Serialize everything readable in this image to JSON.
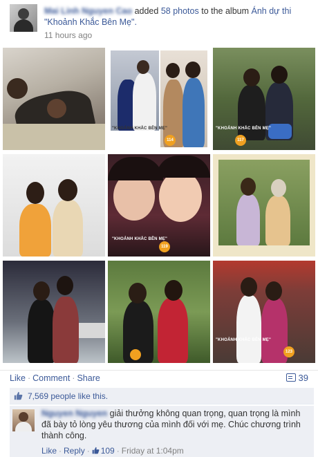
{
  "post": {
    "author_blurred": "Mai Linh Nguyen Cao",
    "action_text": "added",
    "photo_count": "58 photos",
    "to_album_text": "to the album",
    "album_name": "Ánh dự thi \"Khoảnh Khắc Bên Mẹ\".",
    "timestamp": "11 hours ago"
  },
  "photos": [
    {
      "id": "1"
    },
    {
      "id": "2",
      "frame_text": "\"KHOẢNH KHẮC BÊN MẸ\"",
      "badge": "114"
    },
    {
      "id": "3",
      "frame_text": "\"KHOẢNH KHẮC BÊN MẸ\"",
      "badge": "117"
    },
    {
      "id": "4"
    },
    {
      "id": "5",
      "frame_text": "\"KHOẢNH KHẮC BÊN MẸ\"",
      "badge": "119"
    },
    {
      "id": "6"
    },
    {
      "id": "7"
    },
    {
      "id": "8"
    },
    {
      "id": "9",
      "frame_text": "\"KHOẢNH KHẮC BÊN MẸ\"",
      "badge": "123"
    }
  ],
  "actions": {
    "like": "Like",
    "comment": "Comment",
    "share": "Share",
    "comments_count": "39"
  },
  "likes": {
    "text": "7,569 people like this."
  },
  "comment": {
    "author_blurred": "Nguyen Nguyen",
    "text": "giải thưởng không quan trọng, quan trọng là mình đã bày tỏ lòng yêu thương của mình đối với mẹ. Chúc chương trình thành công.",
    "like": "Like",
    "reply": "Reply",
    "like_count": "109",
    "time": "Friday at 1:04pm"
  },
  "colors": {
    "link": "#3b5998",
    "muted": "#808080",
    "comment_bg": "#edeff4",
    "badge": "#f0a020"
  }
}
